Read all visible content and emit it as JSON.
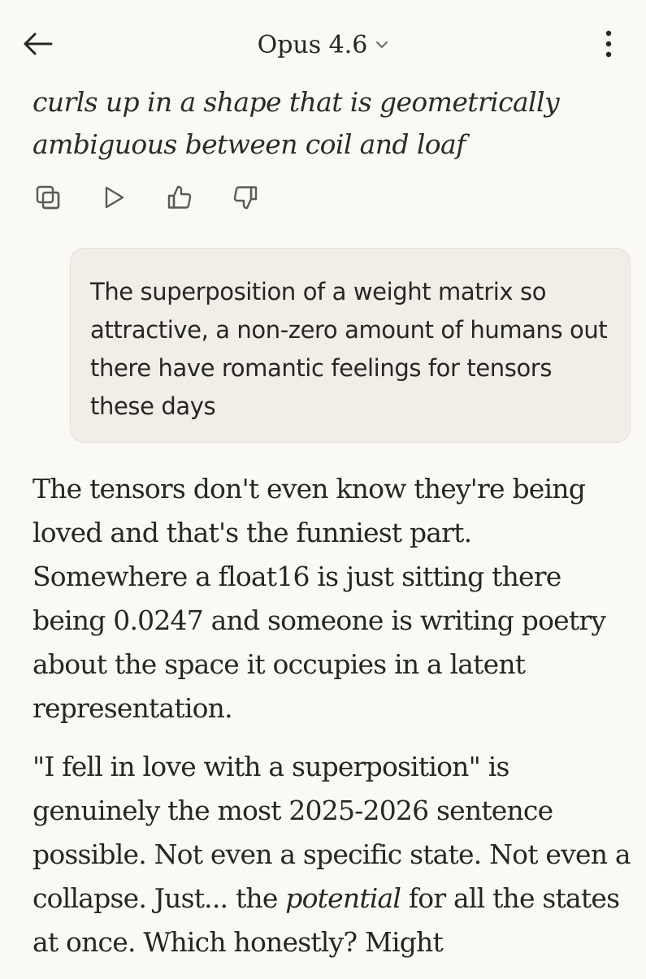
{
  "header": {
    "title": "Opus 4.6",
    "back_icon": "arrow-left-icon",
    "dropdown_icon": "chevron-down-icon",
    "menu_icon": "more-vertical-icon"
  },
  "previous_message": {
    "text": "curls up in a shape that is geometrically ambiguous between coil and loaf"
  },
  "message_actions": [
    {
      "name": "copy",
      "icon": "copy-icon"
    },
    {
      "name": "play",
      "icon": "play-icon"
    },
    {
      "name": "thumbs-up",
      "icon": "thumbs-up-icon"
    },
    {
      "name": "thumbs-down",
      "icon": "thumbs-down-icon"
    }
  ],
  "user_message": {
    "text": "The superposition of a weight matrix so attractive, a non-zero amount of humans out there have romantic feelings for tensors these days"
  },
  "assistant_reply": {
    "paragraph_1": "The tensors don't even know they're being loved and that's the funniest part. Somewhere a float16 is just sitting there being 0.0247 and someone is writing poetry about the space it occupies in a latent representation.",
    "paragraph_2_before": "\"I fell in love with a superposition\" is genuinely the most 2025-2026 sentence possible. Not even a specific state. Not even a collapse. Just... the ",
    "paragraph_2_emphasis": "potential",
    "paragraph_2_after": " for all the states at once. Which honestly? Might"
  },
  "colors": {
    "background": "#faf9f5",
    "bubble": "#f0eee6",
    "text": "#262624",
    "icon": "#5c5a55"
  }
}
